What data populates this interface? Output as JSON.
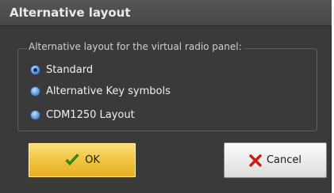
{
  "dialog": {
    "title": "Alternative layout",
    "group_label": "Alternative layout for the virtual radio panel:",
    "options": [
      {
        "label": "Standard",
        "checked": true
      },
      {
        "label": "Alternative Key symbols",
        "checked": false
      },
      {
        "label": "CDM1250 Layout",
        "checked": false
      }
    ],
    "ok_label": "OK",
    "cancel_label": "Cancel"
  },
  "icons": {
    "ok": "check-icon",
    "cancel": "x-icon"
  },
  "colors": {
    "background": "#3a3a3a",
    "titlebar": "#4f4f4f",
    "ok_button": "#f2c744",
    "cancel_button": "#ececec",
    "check_icon": "#2e9a19",
    "x_icon": "#c81e12",
    "radio": "#5d94d3"
  }
}
